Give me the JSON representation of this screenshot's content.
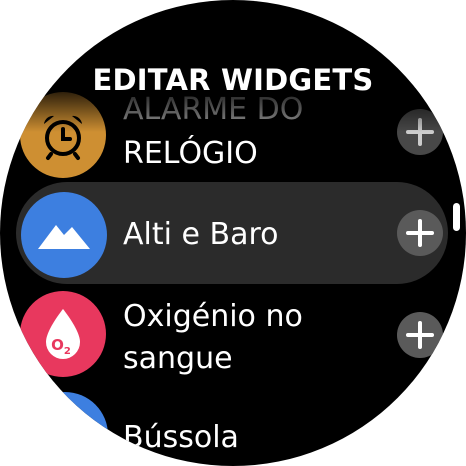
{
  "header": {
    "title": "EDITAR WIDGETS"
  },
  "widgets": [
    {
      "label_line1": "ALARME DO",
      "label_line2": "RELÓGIO",
      "icon": "alarm-clock-icon",
      "icon_color": "#f2a93b",
      "action": "add-icon"
    },
    {
      "label": "Alti e Baro",
      "icon": "mountain-icon",
      "icon_color": "#3d7fe0",
      "action": "add-icon",
      "selected": true
    },
    {
      "label_line1": "Oxigénio no",
      "label_line2": "sangue",
      "icon": "blood-oxygen-icon",
      "icon_color": "#e8385e",
      "icon_text": "O2",
      "action": "add-icon"
    },
    {
      "label": "Bússola",
      "icon": "compass-icon",
      "icon_color": "#3d7fe0"
    }
  ],
  "colors": {
    "background": "#000000",
    "selected_row": "#2b2b2b",
    "add_button": "#5a5a5a"
  }
}
